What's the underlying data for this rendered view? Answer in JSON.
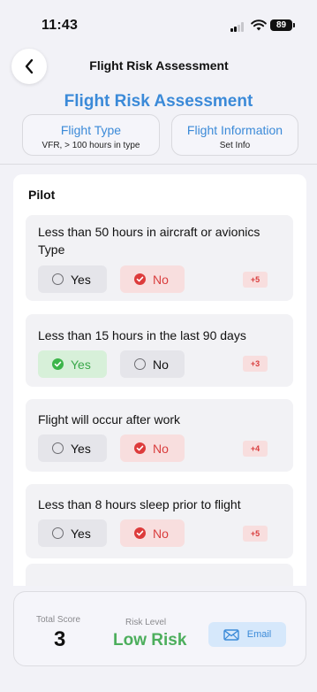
{
  "status": {
    "time": "11:43",
    "battery": "89"
  },
  "nav": {
    "title": "Flight Risk Assessment"
  },
  "header": {
    "title": "Flight Risk Assessment"
  },
  "cards": {
    "flight_type": {
      "title": "Flight Type",
      "subtitle": "VFR, > 100 hours in type"
    },
    "flight_info": {
      "title": "Flight Information",
      "subtitle": "Set Info"
    }
  },
  "section": {
    "title": "Pilot"
  },
  "options": {
    "yes": "Yes",
    "no": "No"
  },
  "questions": [
    {
      "text": "Less than 50 hours in aircraft or avionics Type",
      "selected": "No",
      "points": "+5"
    },
    {
      "text": "Less than 15 hours in the last 90 days",
      "selected": "Yes",
      "points": "+3"
    },
    {
      "text": "Flight will occur after work",
      "selected": "No",
      "points": "+4"
    },
    {
      "text": "Less than 8 hours sleep prior to flight",
      "selected": "No",
      "points": "+5"
    }
  ],
  "footer": {
    "score_label": "Total Score",
    "score": "3",
    "risk_label": "Risk Level",
    "risk": "Low Risk",
    "email_label": "Email"
  },
  "colors": {
    "accent": "#3b8ad8",
    "selected_no": "#dd3b3b",
    "selected_yes": "#3cb54a",
    "low_risk": "#4cae5c"
  }
}
